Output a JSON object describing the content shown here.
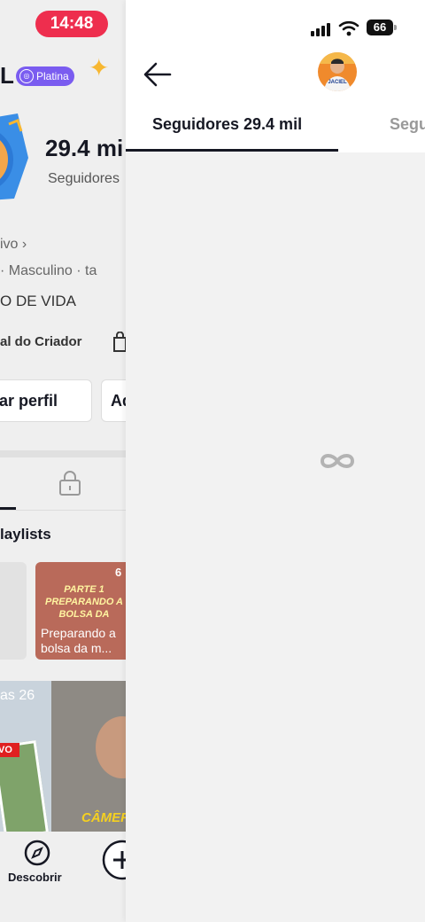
{
  "status_bar": {
    "time": "14:48",
    "battery": "66"
  },
  "background_profile": {
    "name_fragment": "L",
    "badge_label": "Platina",
    "followers_count": "29.4 mi",
    "followers_label": "Seguidores",
    "bio_link_fragment": "ivo ›",
    "info_line": "·  Masculino  ·  ta",
    "bio_text": "O DE VIDA",
    "creator_center_label": "al do Criador",
    "edit_profile_label": "ar perfil",
    "second_button_label": "Ad",
    "playlists_label": "laylists",
    "playlist_card_title": "Preparando a bolsa da m...",
    "playlist_card_overlay": "PARTE 1 PREPARANDO A BOLSA DA",
    "playlist_card_count": "6",
    "video_caption_1": "as 26",
    "video_badge": "VO",
    "video_caption_2": "CÂMER",
    "discover_label": "Descobrir"
  },
  "panel": {
    "tabs": [
      {
        "label": "Seguidores 29.4 mil",
        "active": true
      },
      {
        "label": "Segu",
        "active": false
      }
    ],
    "avatar_text": "JACIEL"
  },
  "colors": {
    "time_pill": "#ee2e4e",
    "badge": "#7a5cf0",
    "tab_active": "#161823",
    "tab_inactive": "#999999",
    "panel_bg": "#f2f2f2"
  }
}
